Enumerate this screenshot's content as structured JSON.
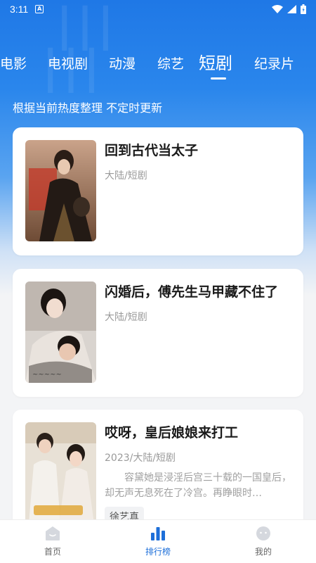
{
  "status_bar": {
    "time": "3:11",
    "notif_icon": "A"
  },
  "tabs": [
    {
      "label": "电影",
      "active": false
    },
    {
      "label": "电视剧",
      "active": false
    },
    {
      "label": "动漫",
      "active": false
    },
    {
      "label": "综艺",
      "active": false
    },
    {
      "label": "短剧",
      "active": true
    },
    {
      "label": "纪录片",
      "active": false
    }
  ],
  "subtitle": "根据当前热度整理 不定时更新",
  "items": [
    {
      "title": "回到古代当太子",
      "meta": "大陆/短剧"
    },
    {
      "title": "闪婚后，傅先生马甲藏不住了",
      "meta": "大陆/短剧"
    },
    {
      "title": "哎呀，皇后娘娘来打工",
      "meta": "2023/大陆/短剧",
      "desc": "容黛她是浸淫后宫三十载的一国皇后，却无声无息死在了冷宫。再睁眼时…",
      "tag": "徐艺真"
    }
  ],
  "nav": [
    {
      "label": "首页",
      "icon": "home-icon",
      "active": false
    },
    {
      "label": "排行榜",
      "icon": "bar-chart-icon",
      "active": true
    },
    {
      "label": "我的",
      "icon": "profile-icon",
      "active": false
    }
  ],
  "colors": {
    "accent": "#1e6fd9",
    "hero": "#1f78e6"
  }
}
